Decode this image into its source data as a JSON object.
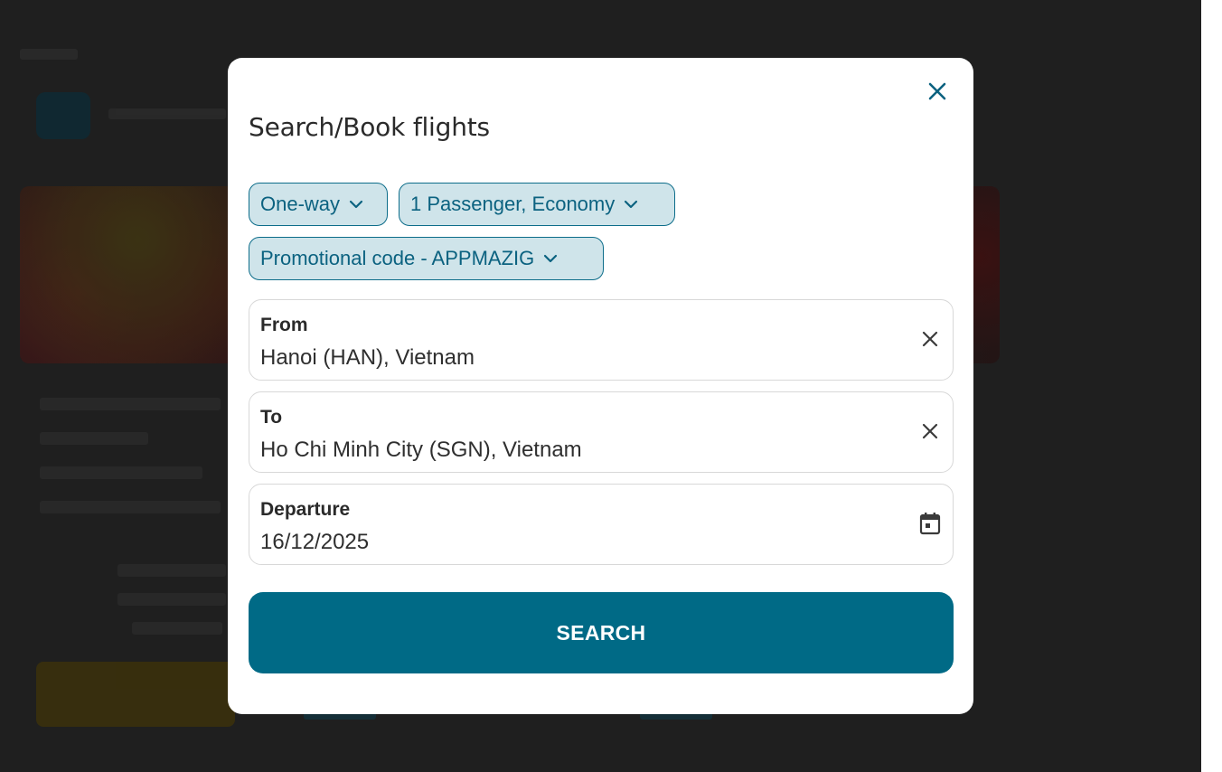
{
  "modal": {
    "title": "Search/Book flights",
    "close_icon": "close-icon"
  },
  "chips": {
    "trip_type": "One-way",
    "passengers": "1 Passenger, Economy",
    "promo": "Promotional code - APPMAZIG"
  },
  "fields": {
    "from": {
      "label": "From",
      "value": "Hanoi (HAN), Vietnam",
      "icon": "clear-icon"
    },
    "to": {
      "label": "To",
      "value": "Ho Chi Minh City (SGN), Vietnam",
      "icon": "clear-icon"
    },
    "departure": {
      "label": "Departure",
      "value": "16/12/2025",
      "icon": "calendar-icon"
    }
  },
  "search_button": {
    "label": "SEARCH"
  },
  "colors": {
    "accent": "#006a86",
    "chip_bg": "#cfe4ea",
    "chip_text": "#0b6280",
    "overlay": "#1f1f1f"
  }
}
